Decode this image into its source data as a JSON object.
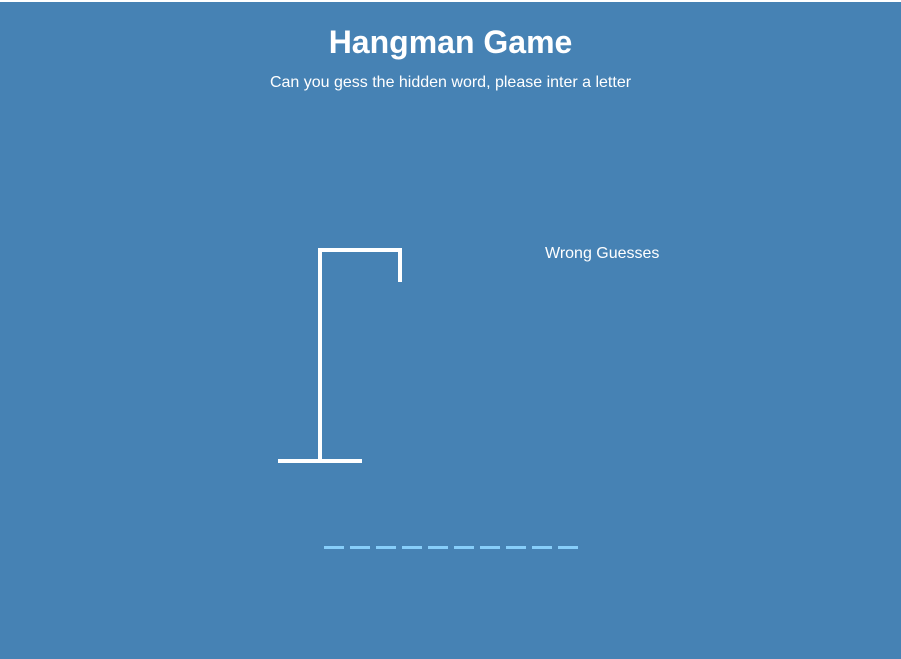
{
  "header": {
    "title": "Hangman Game",
    "subtitle": "Can you gess the hidden word, please inter a letter"
  },
  "wrong_guesses": {
    "title": "Wrong Guesses",
    "letters": ""
  },
  "word": {
    "slots": [
      "",
      "",
      "",
      "",
      "",
      "",
      "",
      "",
      "",
      ""
    ]
  },
  "colors": {
    "background": "#4682b4",
    "text": "#ffffff",
    "figure_stroke": "#ffffff",
    "letter_underline": "#87cefa"
  }
}
